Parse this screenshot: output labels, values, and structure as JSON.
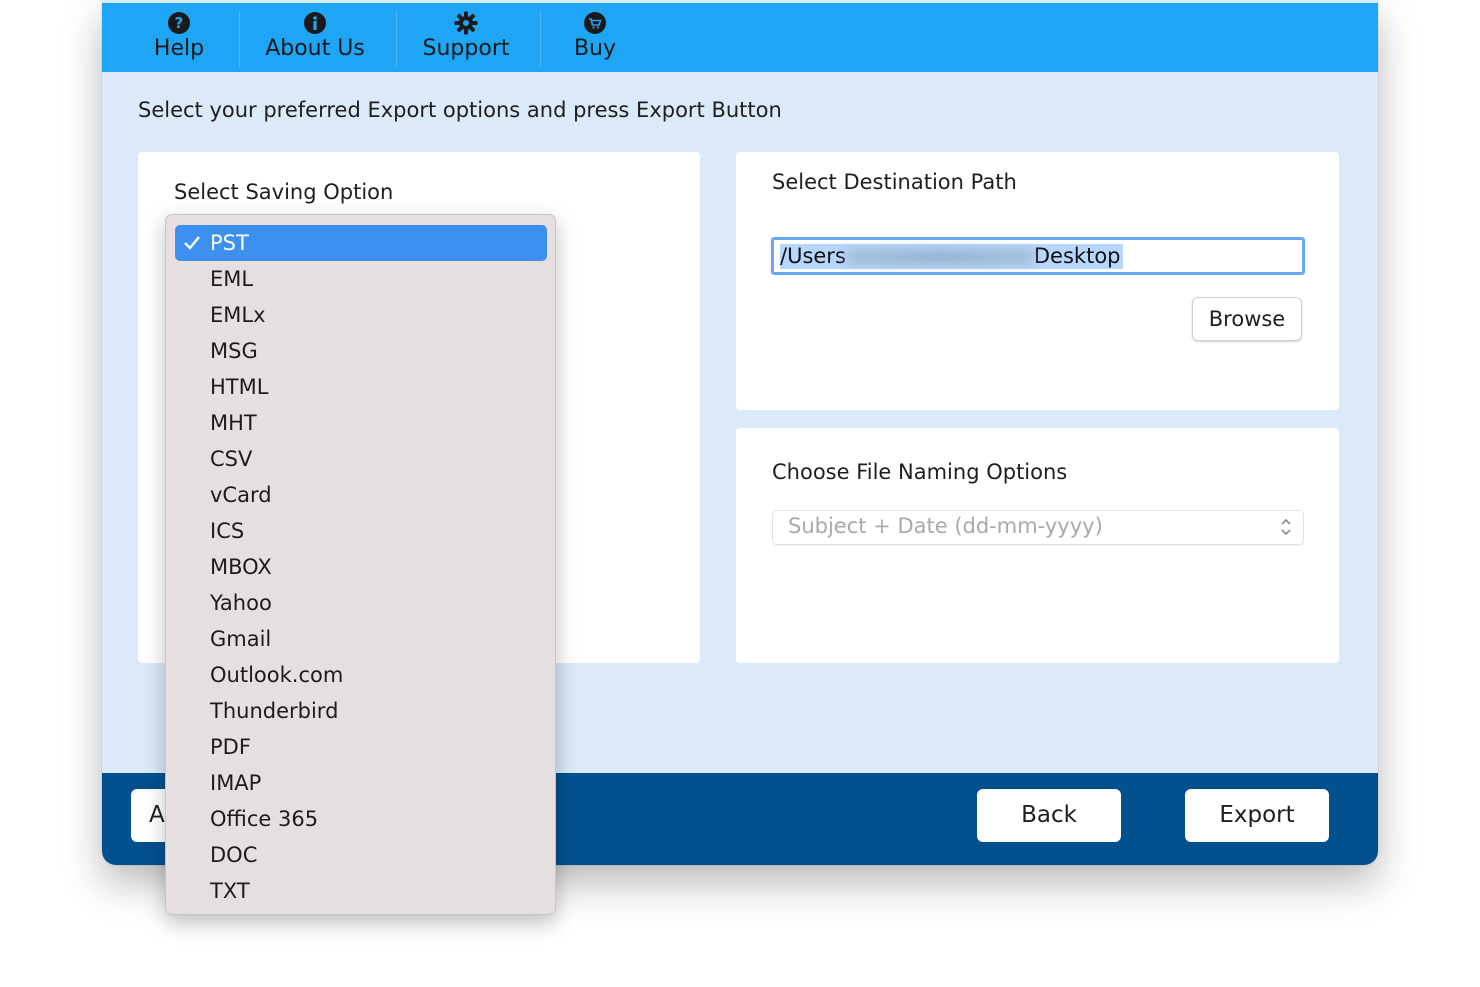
{
  "toolbar": {
    "help": "Help",
    "about": "About Us",
    "support": "Support",
    "buy": "Buy"
  },
  "instruction": "Select your preferred Export options and press Export Button",
  "saving": {
    "title": "Select Saving Option",
    "options": [
      "PST",
      "EML",
      "EMLx",
      "MSG",
      "HTML",
      "MHT",
      "CSV",
      "vCard",
      "ICS",
      "MBOX",
      "Yahoo",
      "Gmail",
      "Outlook.com",
      "Thunderbird",
      "PDF",
      "IMAP",
      "Office 365",
      "DOC",
      "TXT"
    ],
    "selected": "PST"
  },
  "destination": {
    "title": "Select Destination Path",
    "path_start": "/Users",
    "path_end": "Desktop",
    "browse": "Browse"
  },
  "naming": {
    "title": "Choose File Naming Options",
    "value": "Subject + Date (dd-mm-yyyy)"
  },
  "footer": {
    "left_button_partial": "A",
    "back": "Back",
    "export": "Export"
  },
  "colors": {
    "toolbar": "#1ea5f5",
    "footer": "#03508f",
    "background": "#dce9f8",
    "selection": "#3d8ff0"
  }
}
